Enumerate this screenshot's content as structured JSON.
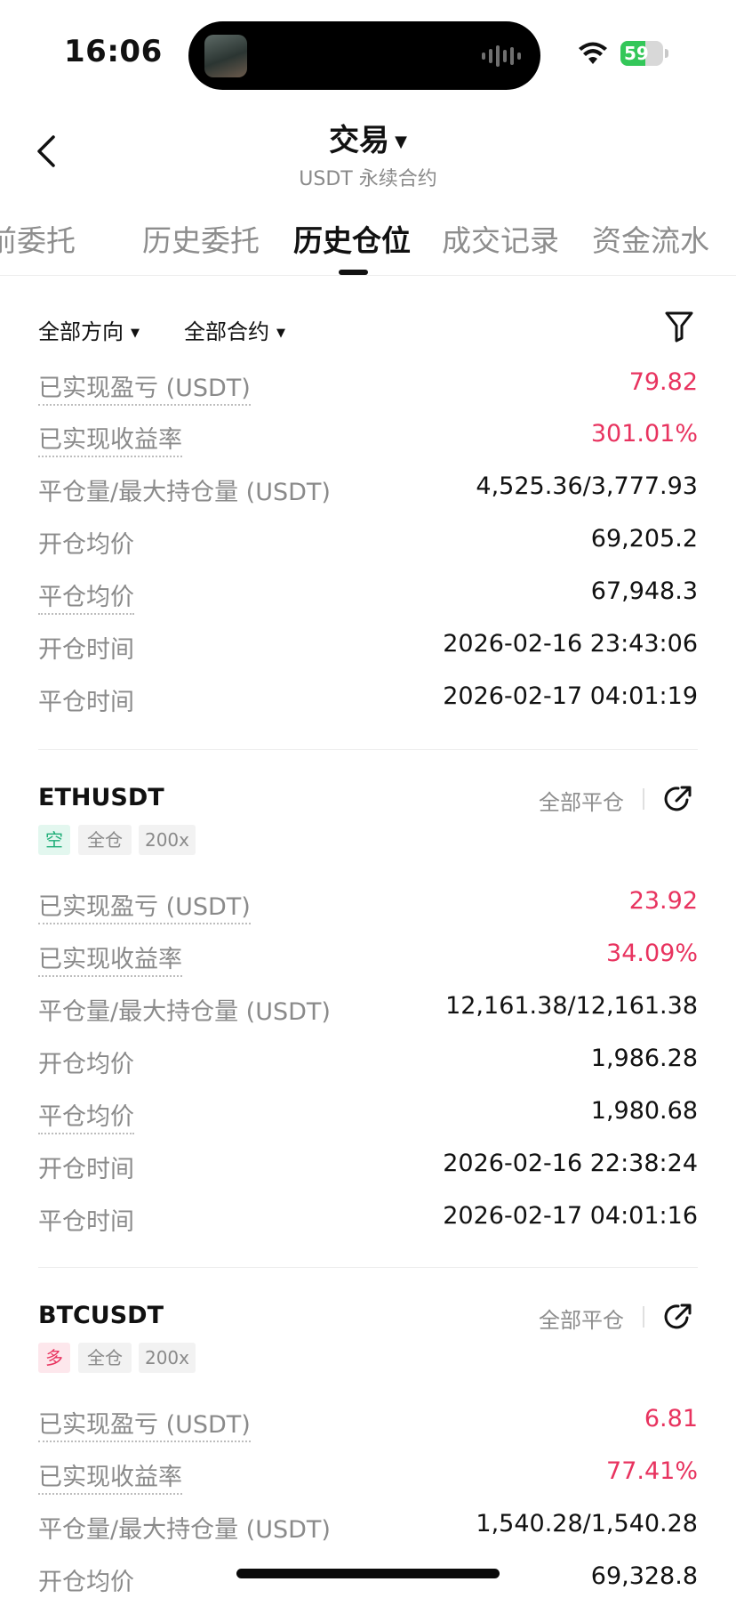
{
  "status_bar": {
    "time": "16:06",
    "battery": "59"
  },
  "header": {
    "title": "交易",
    "subtitle": "USDT 永续合约"
  },
  "tabs": [
    {
      "label": "前委托"
    },
    {
      "label": "历史委托"
    },
    {
      "label": "历史仓位"
    },
    {
      "label": "成交记录"
    },
    {
      "label": "资金流水"
    }
  ],
  "filters": {
    "direction": "全部方向",
    "contract": "全部合约"
  },
  "labels": {
    "realized_pnl": "已实现盈亏 (USDT)",
    "realized_roi": "已实现收益率",
    "close_max_qty": "平仓量/最大持仓量 (USDT)",
    "open_avg": "开仓均价",
    "close_avg": "平仓均价",
    "open_time": "开仓时间",
    "close_time": "平仓时间",
    "close_all": "全部平仓"
  },
  "positions": [
    {
      "realized_pnl": "79.82",
      "realized_roi": "301.01%",
      "close_max_qty": "4,525.36/3,777.93",
      "open_avg": "69,205.2",
      "close_avg": "67,948.3",
      "open_time": "2026-02-16 23:43:06",
      "close_time": "2026-02-17 04:01:19"
    },
    {
      "symbol": "ETHUSDT",
      "side": "空",
      "margin": "全仓",
      "leverage": "200x",
      "realized_pnl": "23.92",
      "realized_roi": "34.09%",
      "close_max_qty": "12,161.38/12,161.38",
      "open_avg": "1,986.28",
      "close_avg": "1,980.68",
      "open_time": "2026-02-16 22:38:24",
      "close_time": "2026-02-17 04:01:16"
    },
    {
      "symbol": "BTCUSDT",
      "side": "多",
      "margin": "全仓",
      "leverage": "200x",
      "realized_pnl": "6.81",
      "realized_roi": "77.41%",
      "close_max_qty": "1,540.28/1,540.28",
      "open_avg": "69,328.8"
    }
  ],
  "colors": {
    "profit": "#e8335f",
    "short": "#1fae78",
    "long": "#e8335f"
  }
}
